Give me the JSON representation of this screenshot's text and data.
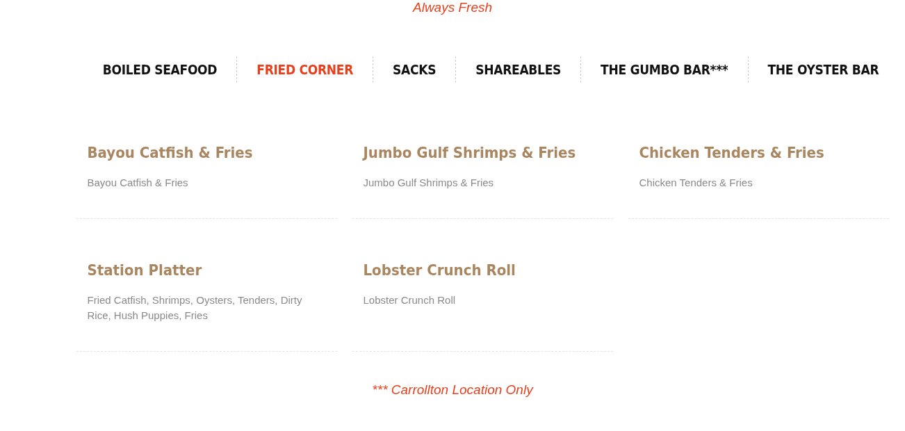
{
  "tagline": "Always Fresh",
  "tabs": [
    {
      "label": "BOILED SEAFOOD",
      "selected": false
    },
    {
      "label": "FRIED CORNER",
      "selected": true
    },
    {
      "label": "SACKS",
      "selected": false
    },
    {
      "label": "SHAREABLES",
      "selected": false
    },
    {
      "label": "THE GUMBO BAR***",
      "selected": false
    },
    {
      "label": "THE OYSTER BAR",
      "selected": false
    }
  ],
  "items": [
    {
      "name": "Bayou Catfish & Fries",
      "description": "Bayou Catfish & Fries"
    },
    {
      "name": "Jumbo Gulf Shrimps & Fries",
      "description": "Jumbo Gulf Shrimps & Fries"
    },
    {
      "name": "Chicken Tenders & Fries",
      "description": "Chicken Tenders & Fries"
    },
    {
      "name": "Station Platter",
      "description": "Fried Catfish, Shrimps, Oysters, Tenders, Dirty Rice, Hush Puppies, Fries"
    },
    {
      "name": "Lobster Crunch Roll",
      "description": "Lobster Crunch Roll"
    }
  ],
  "footnote": "*** Carrollton Location Only"
}
